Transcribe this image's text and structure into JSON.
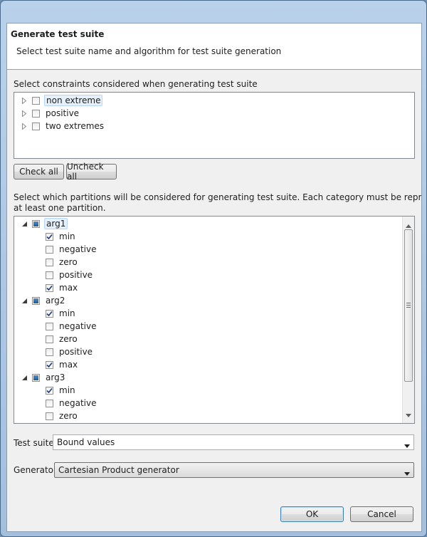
{
  "dialog": {
    "title": "Generate test suite",
    "subtitle": "Select test suite name and algorithm for test suite generation"
  },
  "constraints": {
    "label": "Select constraints considered when generating test suite",
    "items": [
      {
        "label": "non extreme",
        "checked": false
      },
      {
        "label": "positive",
        "checked": false
      },
      {
        "label": "two extremes",
        "checked": false
      }
    ]
  },
  "buttons": {
    "check_all": "Check all",
    "uncheck_all": "Uncheck all",
    "ok": "OK",
    "cancel": "Cancel"
  },
  "partitions": {
    "label_line1": "Select which partitions will be considered for generating test suite. Each category must be represented by",
    "label_line2": "at least one partition.",
    "args": [
      {
        "label": "arg1",
        "children": [
          {
            "label": "min",
            "checked": true
          },
          {
            "label": "negative",
            "checked": false
          },
          {
            "label": "zero",
            "checked": false
          },
          {
            "label": "positive",
            "checked": false
          },
          {
            "label": "max",
            "checked": true
          }
        ]
      },
      {
        "label": "arg2",
        "children": [
          {
            "label": "min",
            "checked": true
          },
          {
            "label": "negative",
            "checked": false
          },
          {
            "label": "zero",
            "checked": false
          },
          {
            "label": "positive",
            "checked": false
          },
          {
            "label": "max",
            "checked": true
          }
        ]
      },
      {
        "label": "arg3",
        "children": [
          {
            "label": "min",
            "checked": true
          },
          {
            "label": "negative",
            "checked": false
          },
          {
            "label": "zero",
            "checked": false
          }
        ]
      }
    ]
  },
  "test_suite": {
    "label": "Test suite",
    "value": "Bound values"
  },
  "generator": {
    "label": "Generator",
    "value": "Cartesian Product generator"
  }
}
